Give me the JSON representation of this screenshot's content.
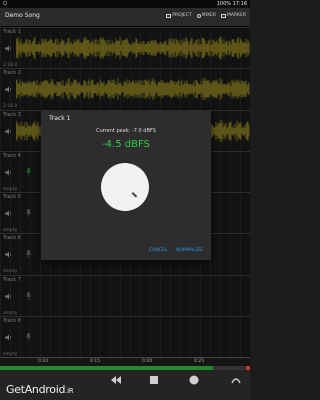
{
  "status_bar": {
    "left": "Q",
    "right": "100% 17:16"
  },
  "app_bar": {
    "title": "Demo Song",
    "actions": [
      {
        "label": "PROJECT"
      },
      {
        "label": "MIXER"
      },
      {
        "label": "MARKER"
      }
    ]
  },
  "tracks": [
    {
      "name": "Track 1",
      "status": "2:16.0",
      "has_audio": true
    },
    {
      "name": "Track 2",
      "status": "2:16.0",
      "has_audio": true
    },
    {
      "name": "Track 3",
      "status": "",
      "has_audio": true
    },
    {
      "name": "Track 4",
      "status": "empty",
      "has_audio": false
    },
    {
      "name": "Track 5",
      "status": "empty",
      "has_audio": false
    },
    {
      "name": "Track 6",
      "status": "empty",
      "has_audio": false
    },
    {
      "name": "Track 7",
      "status": "empty",
      "has_audio": false
    },
    {
      "name": "Track 8",
      "status": "empty",
      "has_audio": false
    }
  ],
  "ruler": [
    "0:10",
    "0:15",
    "0:20",
    "0:25"
  ],
  "transport": {
    "level_fraction": 0.85,
    "logo": "GetAndroid",
    "logo_suffix": ".iR"
  },
  "dialog": {
    "title": "Track 1",
    "peak_text": "Current peak: -7.0 dBFS",
    "value": "-4.5 dBFS",
    "cancel_label": "CANCEL",
    "normalize_label": "NORMALIZE"
  },
  "colors": {
    "waveform": "#a89b2a",
    "accent": "#2ecc40",
    "button": "#2a9df4"
  }
}
